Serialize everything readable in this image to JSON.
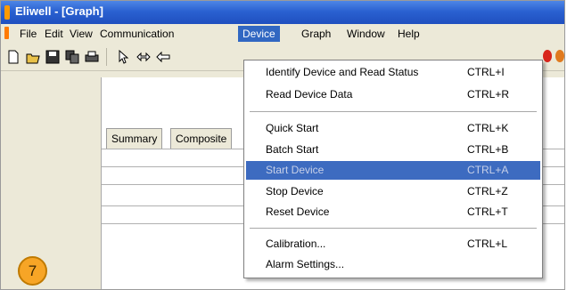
{
  "window": {
    "title": "Eliwell - [Graph]"
  },
  "menubar": {
    "items": [
      "File",
      "Edit",
      "View",
      "Communication",
      "Device",
      "Graph",
      "Window",
      "Help"
    ],
    "active": "Device"
  },
  "toolbar": {
    "icons": [
      "new-icon",
      "open-icon",
      "save-icon",
      "copy-icon",
      "print-icon",
      "pointer-icon",
      "swap-icon"
    ]
  },
  "tabs": [
    "Summary",
    "Composite"
  ],
  "device_menu": {
    "items": [
      {
        "label": "Identify Device and Read Status",
        "shortcut": "CTRL+I"
      },
      {
        "label": "Read Device Data",
        "shortcut": "CTRL+R"
      },
      {
        "label": "Quick Start",
        "shortcut": "CTRL+K"
      },
      {
        "label": "Batch Start",
        "shortcut": "CTRL+B"
      },
      {
        "label": "Start Device",
        "shortcut": "CTRL+A",
        "state": "disabled-highlighted"
      },
      {
        "label": "Stop Device",
        "shortcut": "CTRL+Z"
      },
      {
        "label": "Reset Device",
        "shortcut": "CTRL+T"
      },
      {
        "label": "Calibration...",
        "shortcut": "CTRL+L"
      },
      {
        "label": "Alarm Settings...",
        "shortcut": ""
      }
    ]
  },
  "step_badge": "7",
  "colors": {
    "titlebar": "#2a61d1",
    "menu_highlight": "#3167c2",
    "selected_item": "#3d6bc0",
    "badge": "#f7a526"
  }
}
